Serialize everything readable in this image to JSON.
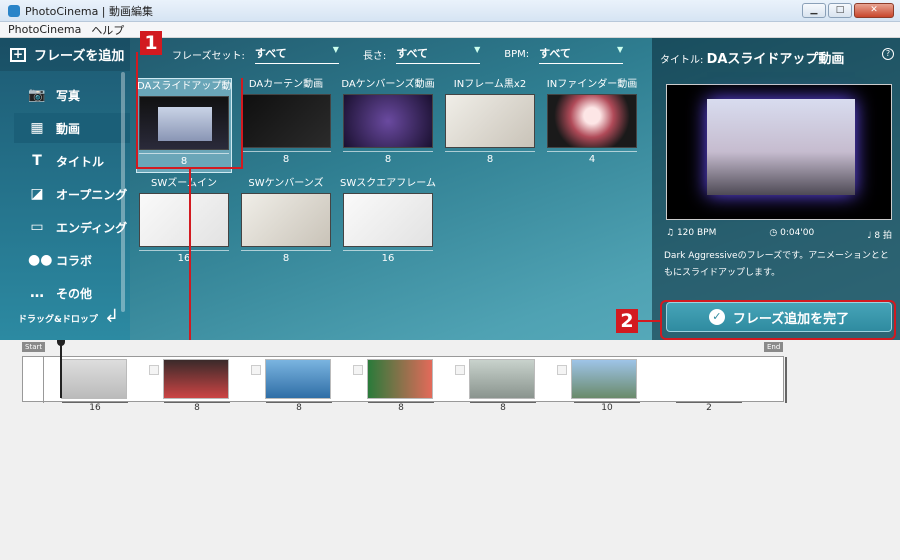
{
  "window": {
    "title": "PhotoCinema | 動画編集",
    "minimize": "▁",
    "maximize": "□",
    "close": "✕"
  },
  "menu": [
    "PhotoCinema",
    "ヘルプ"
  ],
  "sidebar": {
    "header": "フレーズを追加",
    "items": [
      {
        "label": "写真",
        "icon": "camera-icon"
      },
      {
        "label": "動画",
        "icon": "film-icon"
      },
      {
        "label": "タイトル",
        "icon": "title-icon"
      },
      {
        "label": "オープニング",
        "icon": "opening-icon"
      },
      {
        "label": "エンディング",
        "icon": "ending-icon"
      },
      {
        "label": "コラボ",
        "icon": "collab-icon"
      },
      {
        "label": "その他",
        "icon": "more-icon"
      }
    ],
    "active_index": 1,
    "drag_hint": "ドラッグ&ドロップ"
  },
  "filters": [
    {
      "label": "フレーズセット:",
      "value": "すべて"
    },
    {
      "label": "長さ:",
      "value": "すべて"
    },
    {
      "label": "BPM:",
      "value": "すべて"
    }
  ],
  "phrases": [
    {
      "name": "DAスライドアップ動画",
      "count": "8",
      "selected": true
    },
    {
      "name": "DAカーテン動画",
      "count": "8"
    },
    {
      "name": "DAケンバーンズ動画",
      "count": "8"
    },
    {
      "name": "INフレーム黒x2",
      "count": "8"
    },
    {
      "name": "INファインダー動画",
      "count": "4"
    },
    {
      "name": "SWズームイン",
      "count": "16"
    },
    {
      "name": "SWケンバーンズ",
      "count": "8"
    },
    {
      "name": "SWスクエアフレーム",
      "count": "16"
    }
  ],
  "callouts": {
    "one": "1",
    "two": "2"
  },
  "preview": {
    "title_prefix": "タイトル:",
    "title": "DAスライドアップ動画",
    "help": "?",
    "bpm": "120 BPM",
    "duration": "0:04'00",
    "beats": "8 拍",
    "description": "Dark Aggressiveのフレーズです。アニメーションとともにスライドアップします。",
    "finish_button": "フレーズ追加を完了"
  },
  "timeline": {
    "start_label": "Start",
    "end_label": "End",
    "counts": [
      "16",
      "8",
      "8",
      "8",
      "8",
      "10",
      "2"
    ]
  }
}
